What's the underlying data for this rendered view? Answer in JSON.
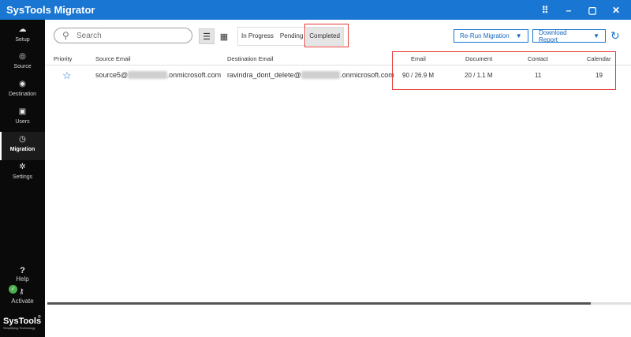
{
  "window": {
    "title": "SysTools Migrator",
    "controls": [
      "⠿",
      "–",
      "▢",
      "✕"
    ]
  },
  "sidebar": {
    "items": [
      {
        "label": "Setup",
        "icon": "cloud-icon",
        "glyph": "☁"
      },
      {
        "label": "Source",
        "icon": "source-icon",
        "glyph": "◎"
      },
      {
        "label": "Destination",
        "icon": "destination-icon",
        "glyph": "◉"
      },
      {
        "label": "Users",
        "icon": "users-icon",
        "glyph": "▣"
      },
      {
        "label": "Migration",
        "icon": "migration-icon",
        "glyph": "◷",
        "active": true
      },
      {
        "label": "Settings",
        "icon": "gear-icon",
        "glyph": "✲"
      }
    ],
    "help_label": "Help",
    "activate_label": "Activate",
    "brand_name": "SysTools",
    "brand_tagline": "Simplifying Technology"
  },
  "toolbar": {
    "search_placeholder": "Search",
    "tabs": [
      {
        "label": "In Progress"
      },
      {
        "label": "Pending"
      },
      {
        "label": "Completed",
        "active": true
      }
    ],
    "rerun_label": "Re-Run Migration",
    "download_label": "Download Report"
  },
  "table": {
    "headers": {
      "priority": "Priority",
      "source": "Source Email",
      "destination": "Destination Email",
      "email": "Email",
      "document": "Document",
      "contact": "Contact",
      "calendar": "Calendar"
    },
    "rows": [
      {
        "source_prefix": "source5@",
        "source_hidden": "xxxxxxxxxxx",
        "source_suffix": ".onmicrosoft.com",
        "dest_prefix": "ravindra_dont_delete@",
        "dest_hidden": "xxxxxxxxxxx",
        "dest_suffix": ".onmicrosoft.com",
        "email": "90 / 26.9 M",
        "document": "20 / 1.1 M",
        "contact": "11",
        "calendar": "19"
      }
    ]
  },
  "colors": {
    "accent": "#1976d2",
    "highlight": "#e53935",
    "sidebar": "#0a0a0a"
  }
}
